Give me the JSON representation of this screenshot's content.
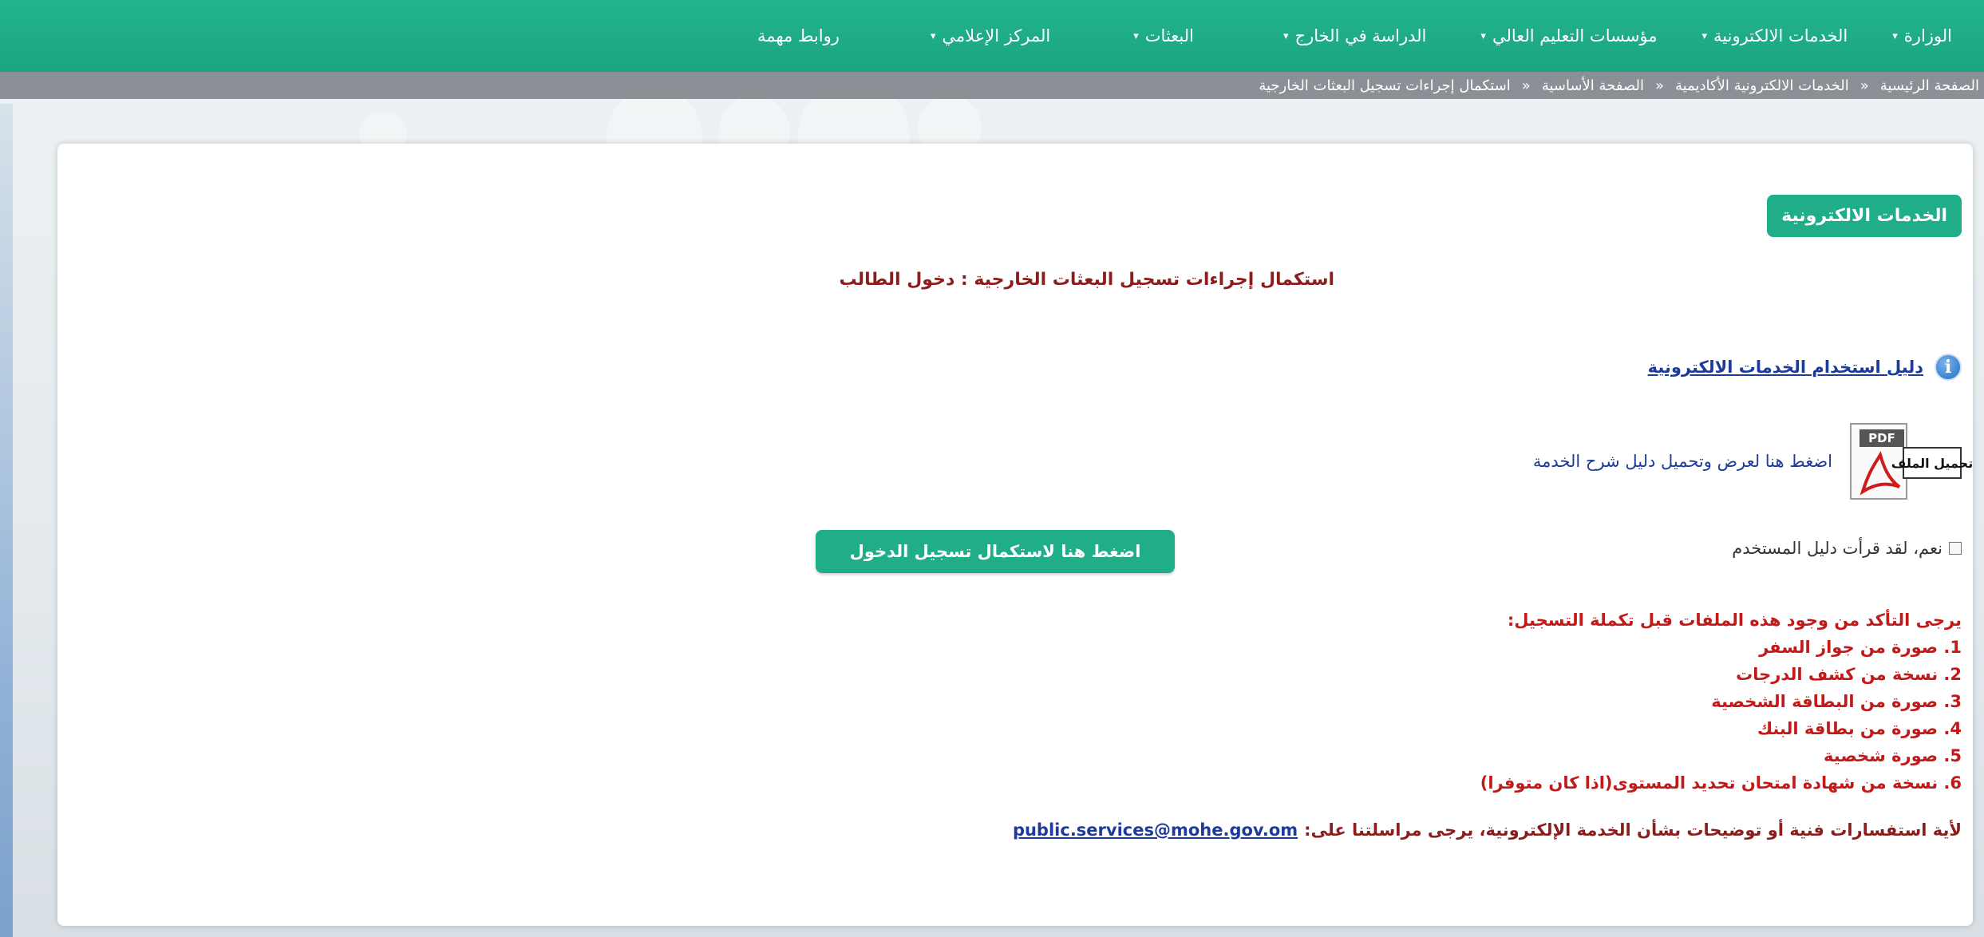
{
  "nav": {
    "items": [
      {
        "label": "الوزارة",
        "has_caret": true
      },
      {
        "label": "الخدمات الالكترونية",
        "has_caret": true
      },
      {
        "label": "مؤسسات التعليم العالي",
        "has_caret": true
      },
      {
        "label": "الدراسة في الخارج",
        "has_caret": true
      },
      {
        "label": "البعثات",
        "has_caret": true
      },
      {
        "label": "المركز الإعلامي",
        "has_caret": true
      },
      {
        "label": "روابط مهمة",
        "has_caret": false
      }
    ],
    "caret_glyph": "▾"
  },
  "breadcrumb": {
    "items": [
      "الصفحة الرئيسية",
      "الخدمات الالكترونية الأكاديمية",
      "الصفحة الأساسية",
      "استكمال إجراءات تسجيل البعثات الخارجية"
    ],
    "separator": "«"
  },
  "card": {
    "section_badge": "الخدمات الالكترونية",
    "heading": "استكمال إجراءات تسجيل البعثات الخارجية : دخول الطالب",
    "guide_link": "دليل استخدام الخدمات الالكترونية",
    "info_icon_glyph": "i",
    "pdf": {
      "download_label": "تحميل الملف",
      "badge": "PDF",
      "link_text": "اضغط هنا لعرض وتحميل دليل شرح الخدمة"
    },
    "confirm_checkbox_label": "نعم، لقد قرأت دليل المستخدم",
    "confirm_checked": false,
    "login_button": "اضغط هنا لاستكمال تسجيل الدخول",
    "requirements": {
      "title": "يرجى التأكد من وجود هذه الملفات قبل تكملة التسجيل:",
      "items": [
        "1. صورة من جواز السفر",
        "2. نسخة من كشف الدرجات",
        "3. صورة من البطاقة الشخصية",
        "4. صورة من بطاقة البنك",
        "5. صورة شخصية",
        "6. نسخة من شهادة امتحان تحديد المستوى(اذا كان متوفرا)"
      ]
    },
    "contact": {
      "text": "لأية استفسارات فنية أو توضيحات بشأن الخدمة الإلكترونية، يرجى مراسلتنا على:",
      "email": "public.services@mohe.gov.om"
    }
  },
  "colors": {
    "nav_green": "#1fae88",
    "breadcrumb_gray": "#8a9095",
    "heading_red": "#8b1d1d",
    "requirements_red": "#c11a1a",
    "link_blue": "#1d3b9a"
  }
}
